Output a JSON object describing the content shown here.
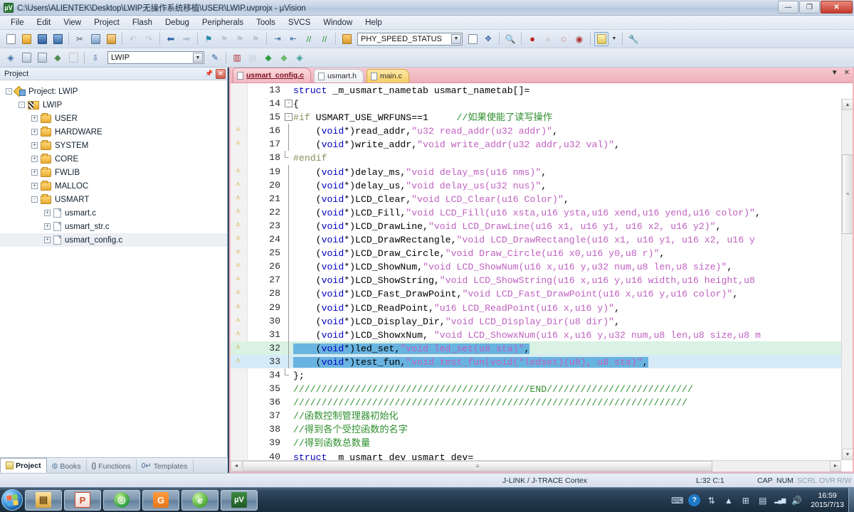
{
  "window": {
    "title": "C:\\Users\\ALIENTEK\\Desktop\\LWIP无操作系统移植\\USER\\LWIP.uvprojx - µVision",
    "app_icon": "uvision-icon",
    "minimize": "—",
    "maximize": "❐",
    "close": "✕"
  },
  "menu": [
    "File",
    "Edit",
    "View",
    "Project",
    "Flash",
    "Debug",
    "Peripherals",
    "Tools",
    "SVCS",
    "Window",
    "Help"
  ],
  "toolbar_row1": {
    "combo_value": "PHY_SPEED_STATUS",
    "icons": [
      "new-file-icon",
      "open-file-icon",
      "save-icon",
      "save-all-icon",
      "cut-icon",
      "copy-icon",
      "paste-icon",
      "undo-icon",
      "redo-icon",
      "back-icon",
      "forward-icon",
      "bookmark-toggle-icon",
      "bookmark-prev-icon",
      "bookmark-next-icon",
      "bookmark-clear-icon",
      "indent-icon",
      "outdent-icon",
      "comment-icon",
      "uncomment-icon",
      "insert-folder-icon",
      "combo-dropdown-icon",
      "find-in-files-icon",
      "configure-icon",
      "find-icon",
      "start-debug-icon",
      "stop-debug-icon",
      "insert-bookmark-icon",
      "breakpoint-icon",
      "window-layout-icon",
      "window-layout-dropdown-icon",
      "settings-wrench-icon"
    ]
  },
  "toolbar_row2": {
    "target_value": "LWIP",
    "icons": [
      "translate-icon",
      "build-icon",
      "rebuild-icon",
      "batch-build-icon",
      "stop-build-icon",
      "download-icon",
      "target-options-icon",
      "manage-project-items-icon",
      "pack-installer-icon",
      "run-to-main-icon",
      "multi-project-icon",
      "svcs-icon"
    ]
  },
  "project_panel": {
    "title": "Project",
    "pin_icon": "pin-icon",
    "close_icon": "close-icon",
    "tree": [
      {
        "label": "Project: LWIP",
        "indent": 0,
        "expander": "-",
        "icon": "project-icon"
      },
      {
        "label": "LWIP",
        "indent": 1,
        "expander": "-",
        "icon": "target-icon"
      },
      {
        "label": "USER",
        "indent": 2,
        "expander": "+",
        "icon": "folder-icon"
      },
      {
        "label": "HARDWARE",
        "indent": 2,
        "expander": "+",
        "icon": "folder-icon"
      },
      {
        "label": "SYSTEM",
        "indent": 2,
        "expander": "+",
        "icon": "folder-icon"
      },
      {
        "label": "CORE",
        "indent": 2,
        "expander": "+",
        "icon": "folder-icon"
      },
      {
        "label": "FWLIB",
        "indent": 2,
        "expander": "+",
        "icon": "folder-icon"
      },
      {
        "label": "MALLOC",
        "indent": 2,
        "expander": "+",
        "icon": "folder-icon"
      },
      {
        "label": "USMART",
        "indent": 2,
        "expander": "-",
        "icon": "folder-icon"
      },
      {
        "label": "usmart.c",
        "indent": 3,
        "expander": "+",
        "icon": "file-icon"
      },
      {
        "label": "usmart_str.c",
        "indent": 3,
        "expander": "+",
        "icon": "file-icon"
      },
      {
        "label": "usmart_config.c",
        "indent": 3,
        "expander": "+",
        "icon": "file-icon",
        "selected": true
      }
    ],
    "bottom_tabs": [
      {
        "label": "Project",
        "icon": "project-tab-icon",
        "active": true
      },
      {
        "label": "Books",
        "icon": "books-icon",
        "active": false
      },
      {
        "label": "Functions",
        "icon": "functions-icon",
        "active": false
      },
      {
        "label": "Templates",
        "icon": "templates-icon",
        "active": false
      }
    ]
  },
  "editor": {
    "tabs": [
      {
        "label": "usmart_config.c",
        "active": true,
        "kind": "c-active"
      },
      {
        "label": "usmart.h",
        "active": false,
        "kind": "h"
      },
      {
        "label": "main.c",
        "active": false,
        "kind": "c"
      }
    ],
    "tab_nav": {
      "dropdown": "▼",
      "close": "✕"
    },
    "scroll": {
      "up": "▲",
      "down": "▼",
      "left": "◄",
      "right": "►",
      "thumb_grip": "≡"
    },
    "lines": [
      {
        "no": "13",
        "warn": false,
        "fold": "",
        "segments": [
          {
            "t": "struct ",
            "c": "k"
          },
          {
            "t": "_m_usmart_nametab usmart_nametab[]=",
            "c": "plain"
          }
        ]
      },
      {
        "no": "14",
        "warn": false,
        "fold": "minus",
        "segments": [
          {
            "t": "{",
            "c": "plain"
          }
        ]
      },
      {
        "no": "15",
        "warn": false,
        "fold": "minus2",
        "segments": [
          {
            "t": "#if ",
            "c": "pp"
          },
          {
            "t": "USMART_USE_WRFUNS==1",
            "c": "plain"
          },
          {
            "t": "     //如果使能了读写操作",
            "c": "cmt"
          }
        ]
      },
      {
        "no": "16",
        "warn": true,
        "fold": "bar",
        "segments": [
          {
            "t": "    (",
            "c": "plain"
          },
          {
            "t": "void",
            "c": "k"
          },
          {
            "t": "*)read_addr,",
            "c": "plain"
          },
          {
            "t": "\"u32 read_addr(u32 addr)\"",
            "c": "str"
          },
          {
            "t": ",",
            "c": "plain"
          }
        ]
      },
      {
        "no": "17",
        "warn": true,
        "fold": "bar",
        "segments": [
          {
            "t": "    (",
            "c": "plain"
          },
          {
            "t": "void",
            "c": "k"
          },
          {
            "t": "*)write_addr,",
            "c": "plain"
          },
          {
            "t": "\"void write_addr(u32 addr,u32 val)\"",
            "c": "str"
          },
          {
            "t": ",",
            "c": "plain"
          }
        ]
      },
      {
        "no": "18",
        "warn": false,
        "fold": "end",
        "segments": [
          {
            "t": "#endif",
            "c": "pp"
          }
        ]
      },
      {
        "no": "19",
        "warn": true,
        "fold": "bar2",
        "segments": [
          {
            "t": "    (",
            "c": "plain"
          },
          {
            "t": "void",
            "c": "k"
          },
          {
            "t": "*)delay_ms,",
            "c": "plain"
          },
          {
            "t": "\"void delay_ms(u16 nms)\"",
            "c": "str"
          },
          {
            "t": ",",
            "c": "plain"
          }
        ]
      },
      {
        "no": "20",
        "warn": true,
        "fold": "bar2",
        "segments": [
          {
            "t": "    (",
            "c": "plain"
          },
          {
            "t": "void",
            "c": "k"
          },
          {
            "t": "*)delay_us,",
            "c": "plain"
          },
          {
            "t": "\"void delay_us(u32 nus)\"",
            "c": "str"
          },
          {
            "t": ",",
            "c": "plain"
          }
        ]
      },
      {
        "no": "21",
        "warn": true,
        "fold": "bar2",
        "segments": [
          {
            "t": "    (",
            "c": "plain"
          },
          {
            "t": "void",
            "c": "k"
          },
          {
            "t": "*)LCD_Clear,",
            "c": "plain"
          },
          {
            "t": "\"void LCD_Clear(u16 Color)\"",
            "c": "str"
          },
          {
            "t": ",",
            "c": "plain"
          }
        ]
      },
      {
        "no": "22",
        "warn": true,
        "fold": "bar2",
        "segments": [
          {
            "t": "    (",
            "c": "plain"
          },
          {
            "t": "void",
            "c": "k"
          },
          {
            "t": "*)LCD_Fill,",
            "c": "plain"
          },
          {
            "t": "\"void LCD_Fill(u16 xsta,u16 ysta,u16 xend,u16 yend,u16 color)\"",
            "c": "str"
          },
          {
            "t": ",",
            "c": "plain"
          }
        ]
      },
      {
        "no": "23",
        "warn": true,
        "fold": "bar2",
        "segments": [
          {
            "t": "    (",
            "c": "plain"
          },
          {
            "t": "void",
            "c": "k"
          },
          {
            "t": "*)LCD_DrawLine,",
            "c": "plain"
          },
          {
            "t": "\"void LCD_DrawLine(u16 x1, u16 y1, u16 x2, u16 y2)\"",
            "c": "str"
          },
          {
            "t": ",",
            "c": "plain"
          }
        ]
      },
      {
        "no": "24",
        "warn": true,
        "fold": "bar2",
        "segments": [
          {
            "t": "    (",
            "c": "plain"
          },
          {
            "t": "void",
            "c": "k"
          },
          {
            "t": "*)LCD_DrawRectangle,",
            "c": "plain"
          },
          {
            "t": "\"void LCD_DrawRectangle(u16 x1, u16 y1, u16 x2, u16 y",
            "c": "str"
          }
        ]
      },
      {
        "no": "25",
        "warn": true,
        "fold": "bar2",
        "segments": [
          {
            "t": "    (",
            "c": "plain"
          },
          {
            "t": "void",
            "c": "k"
          },
          {
            "t": "*)LCD_Draw_Circle,",
            "c": "plain"
          },
          {
            "t": "\"void Draw_Circle(u16 x0,u16 y0,u8 r)\"",
            "c": "str"
          },
          {
            "t": ",",
            "c": "plain"
          }
        ]
      },
      {
        "no": "26",
        "warn": true,
        "fold": "bar2",
        "segments": [
          {
            "t": "    (",
            "c": "plain"
          },
          {
            "t": "void",
            "c": "k"
          },
          {
            "t": "*)LCD_ShowNum,",
            "c": "plain"
          },
          {
            "t": "\"void LCD_ShowNum(u16 x,u16 y,u32 num,u8 len,u8 size)\"",
            "c": "str"
          },
          {
            "t": ",",
            "c": "plain"
          }
        ]
      },
      {
        "no": "27",
        "warn": true,
        "fold": "bar2",
        "segments": [
          {
            "t": "    (",
            "c": "plain"
          },
          {
            "t": "void",
            "c": "k"
          },
          {
            "t": "*)LCD_ShowString,",
            "c": "plain"
          },
          {
            "t": "\"void LCD_ShowString(u16 x,u16 y,u16 width,u16 height,u8",
            "c": "str"
          }
        ]
      },
      {
        "no": "28",
        "warn": true,
        "fold": "bar2",
        "segments": [
          {
            "t": "    (",
            "c": "plain"
          },
          {
            "t": "void",
            "c": "k"
          },
          {
            "t": "*)LCD_Fast_DrawPoint,",
            "c": "plain"
          },
          {
            "t": "\"void LCD_Fast_DrawPoint(u16 x,u16 y,u16 color)\"",
            "c": "str"
          },
          {
            "t": ",",
            "c": "plain"
          }
        ]
      },
      {
        "no": "29",
        "warn": true,
        "fold": "bar2",
        "segments": [
          {
            "t": "    (",
            "c": "plain"
          },
          {
            "t": "void",
            "c": "k"
          },
          {
            "t": "*)LCD_ReadPoint,",
            "c": "plain"
          },
          {
            "t": "\"u16 LCD_ReadPoint(u16 x,u16 y)\"",
            "c": "str"
          },
          {
            "t": ",",
            "c": "plain"
          }
        ]
      },
      {
        "no": "30",
        "warn": true,
        "fold": "bar2",
        "segments": [
          {
            "t": "    (",
            "c": "plain"
          },
          {
            "t": "void",
            "c": "k"
          },
          {
            "t": "*)LCD_Display_Dir,",
            "c": "plain"
          },
          {
            "t": "\"void LCD_Display_Dir(u8 dir)\"",
            "c": "str"
          },
          {
            "t": ",",
            "c": "plain"
          }
        ]
      },
      {
        "no": "31",
        "warn": true,
        "fold": "bar2",
        "segments": [
          {
            "t": "    (",
            "c": "plain"
          },
          {
            "t": "void",
            "c": "k"
          },
          {
            "t": "*)LCD_ShowxNum, ",
            "c": "plain"
          },
          {
            "t": "\"void LCD_ShowxNum(u16 x,u16 y,u32 num,u8 len,u8 size,u8 m",
            "c": "str"
          }
        ]
      },
      {
        "no": "32",
        "warn": true,
        "fold": "bar2",
        "selected": true,
        "greenrow": true,
        "segments": [
          {
            "t": "    (",
            "c": "plain hl"
          },
          {
            "t": "void",
            "c": "k hl"
          },
          {
            "t": "*)led_set,",
            "c": "plain hl"
          },
          {
            "t": "\"void led_set(u8 sta)\"",
            "c": "str hl"
          },
          {
            "t": ",",
            "c": "plain hl"
          }
        ]
      },
      {
        "no": "33",
        "warn": true,
        "fold": "bar2",
        "selected": true,
        "segments": [
          {
            "t": "    (",
            "c": "plain hl"
          },
          {
            "t": "void",
            "c": "k hl"
          },
          {
            "t": "*)test_fun,",
            "c": "plain hl"
          },
          {
            "t": "\"void test_fun(void(*ledset)(u8), u8 sta)\"",
            "c": "str hl"
          },
          {
            "t": ",",
            "c": "plain hl"
          }
        ]
      },
      {
        "no": "34",
        "warn": false,
        "fold": "end",
        "segments": [
          {
            "t": "};",
            "c": "plain"
          }
        ]
      },
      {
        "no": "35",
        "warn": false,
        "fold": "",
        "segments": [
          {
            "t": "//////////////////////////////////////////END//////////////////////////",
            "c": "cmt"
          }
        ]
      },
      {
        "no": "36",
        "warn": false,
        "fold": "",
        "segments": [
          {
            "t": "//////////////////////////////////////////////////////////////////////",
            "c": "cmt"
          }
        ]
      },
      {
        "no": "37",
        "warn": false,
        "fold": "",
        "segments": [
          {
            "t": "//函数控制管理器初始化",
            "c": "cmt"
          }
        ]
      },
      {
        "no": "38",
        "warn": false,
        "fold": "",
        "segments": [
          {
            "t": "//得到各个受控函数的名字",
            "c": "cmt"
          }
        ]
      },
      {
        "no": "39",
        "warn": false,
        "fold": "",
        "segments": [
          {
            "t": "//得到函数总数量",
            "c": "cmt"
          }
        ]
      },
      {
        "no": "40",
        "warn": false,
        "fold": "",
        "segments": [
          {
            "t": "struct ",
            "c": "k"
          },
          {
            "t": "_m_usmart_dev usmart_dev=",
            "c": "plain"
          }
        ]
      }
    ]
  },
  "statusbar": {
    "debugger": "J-LINK / J-TRACE Cortex",
    "position": "L:32 C:1",
    "cap": "CAP",
    "num": "NUM",
    "scrl": "SCRL",
    "ovr": "OVR",
    "rw": "R/W"
  },
  "taskbar": {
    "start_label": "start-orb",
    "apps": [
      {
        "name": "file-explorer-icon",
        "glyph": "🗂",
        "color": "#f0c870"
      },
      {
        "name": "powerpoint-icon",
        "glyph": "P",
        "color": "#d24726"
      },
      {
        "name": "360-browser-icon",
        "glyph": "◎",
        "color": "#2f9e44"
      },
      {
        "name": "pdf-reader-icon",
        "glyph": "G",
        "color": "#e8751a"
      },
      {
        "name": "sogou-browser-icon",
        "glyph": "e",
        "color": "#5cb85c"
      },
      {
        "name": "uvision-icon",
        "glyph": "V",
        "color": "#2e6b32"
      }
    ],
    "tray": [
      {
        "name": "keyboard-icon",
        "glyph": "⌨"
      },
      {
        "name": "help-icon",
        "glyph": "?"
      },
      {
        "name": "network-tray-icon",
        "glyph": "⇅"
      },
      {
        "name": "show-hidden-icons-icon",
        "glyph": "▲"
      },
      {
        "name": "windows-defender-icon",
        "glyph": "⊞"
      },
      {
        "name": "safe-removal-icon",
        "glyph": "▤"
      },
      {
        "name": "network-signal-icon",
        "glyph": "▂▄▆"
      },
      {
        "name": "volume-icon",
        "glyph": "🔊"
      }
    ],
    "clock_time": "16:59",
    "clock_date": "2015/7/13"
  }
}
